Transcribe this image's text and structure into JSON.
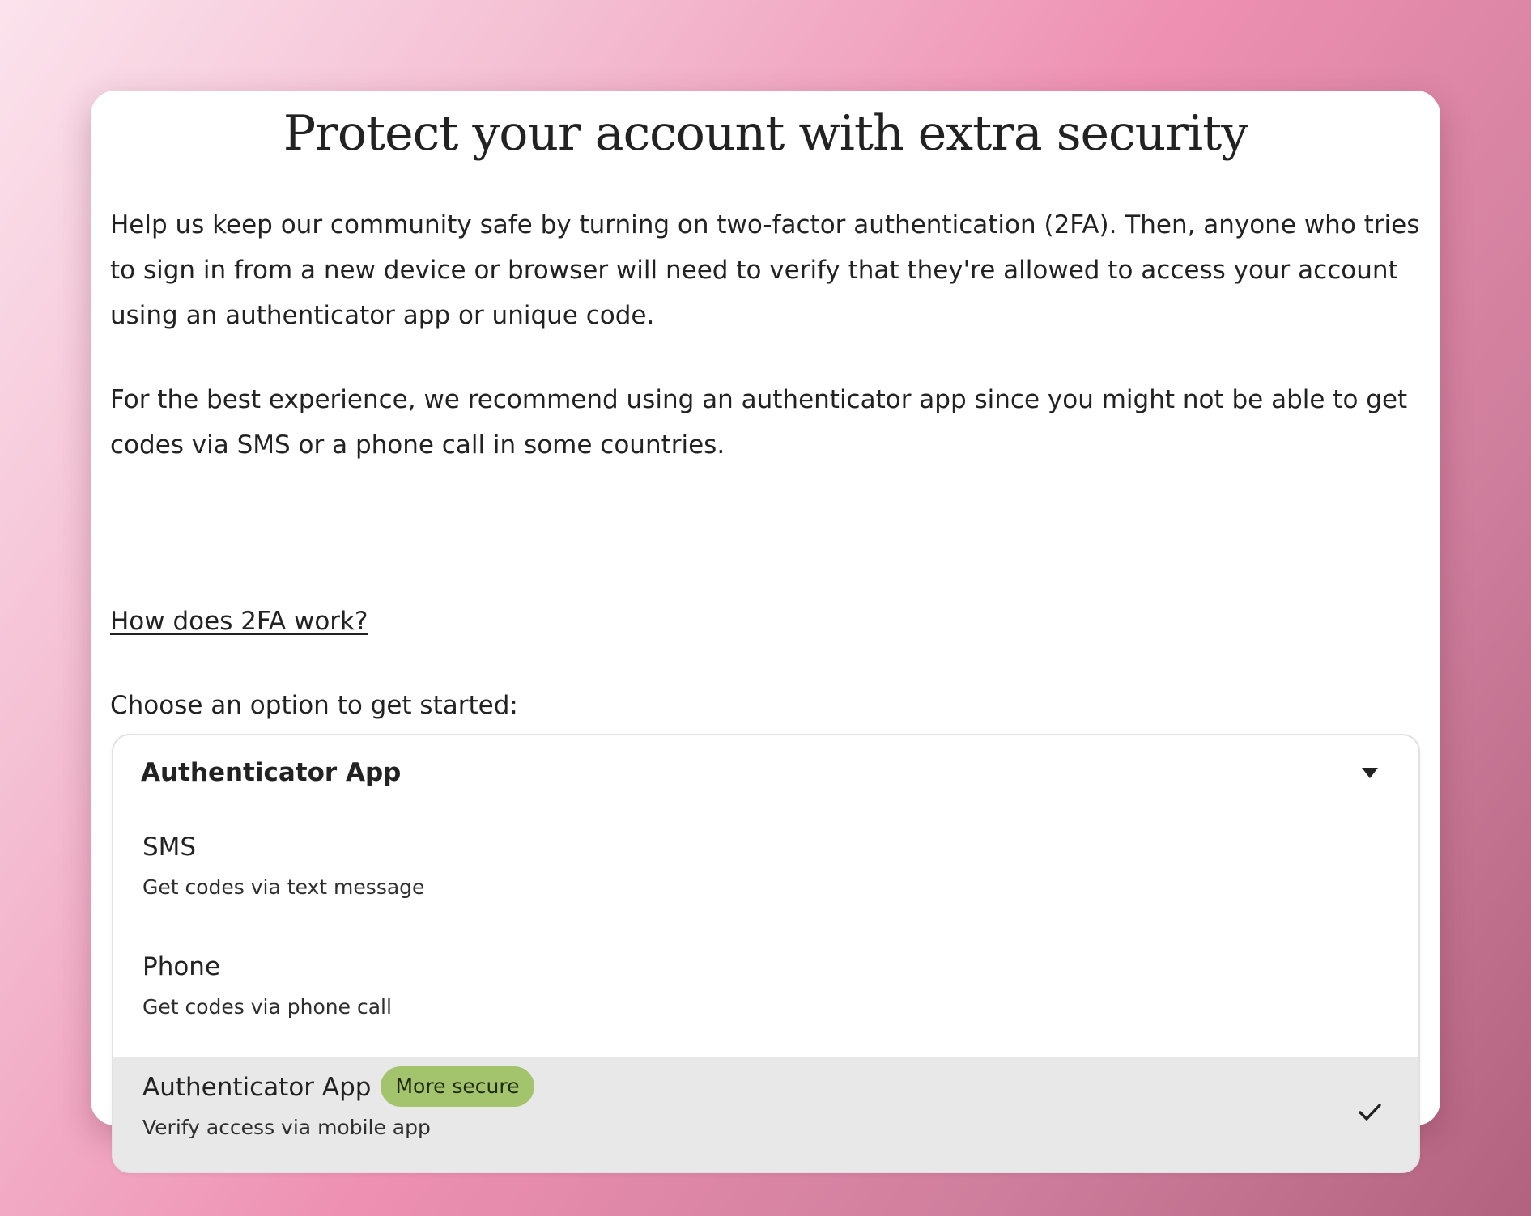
{
  "dialog": {
    "title": "Protect your account with extra security",
    "paragraph1": "Help us keep our community safe by turning on two-factor authentication (2FA). Then, anyone who tries to sign in from a new device or browser will need to verify that they're allowed to access your account using an authenticator app or unique code.",
    "paragraph2": "For the best experience, we recommend using an authenticator app since you might not be able to get codes via SMS or a phone call in some countries.",
    "help_link": "How does 2FA work?",
    "choose_label": "Choose an option to get started:"
  },
  "select": {
    "selected_value": "Authenticator App",
    "caret_icon": "chevron-down-icon",
    "options": [
      {
        "title": "SMS",
        "description": "Get codes via text message",
        "selected": false
      },
      {
        "title": "Phone",
        "description": "Get codes via phone call",
        "selected": false
      },
      {
        "title": "Authenticator App",
        "badge": "More secure",
        "description": "Verify access via mobile app",
        "selected": true
      }
    ]
  },
  "colors": {
    "badge_bg": "#a3c46d",
    "selected_option_bg": "#e8e8e9",
    "text": "#222222"
  }
}
